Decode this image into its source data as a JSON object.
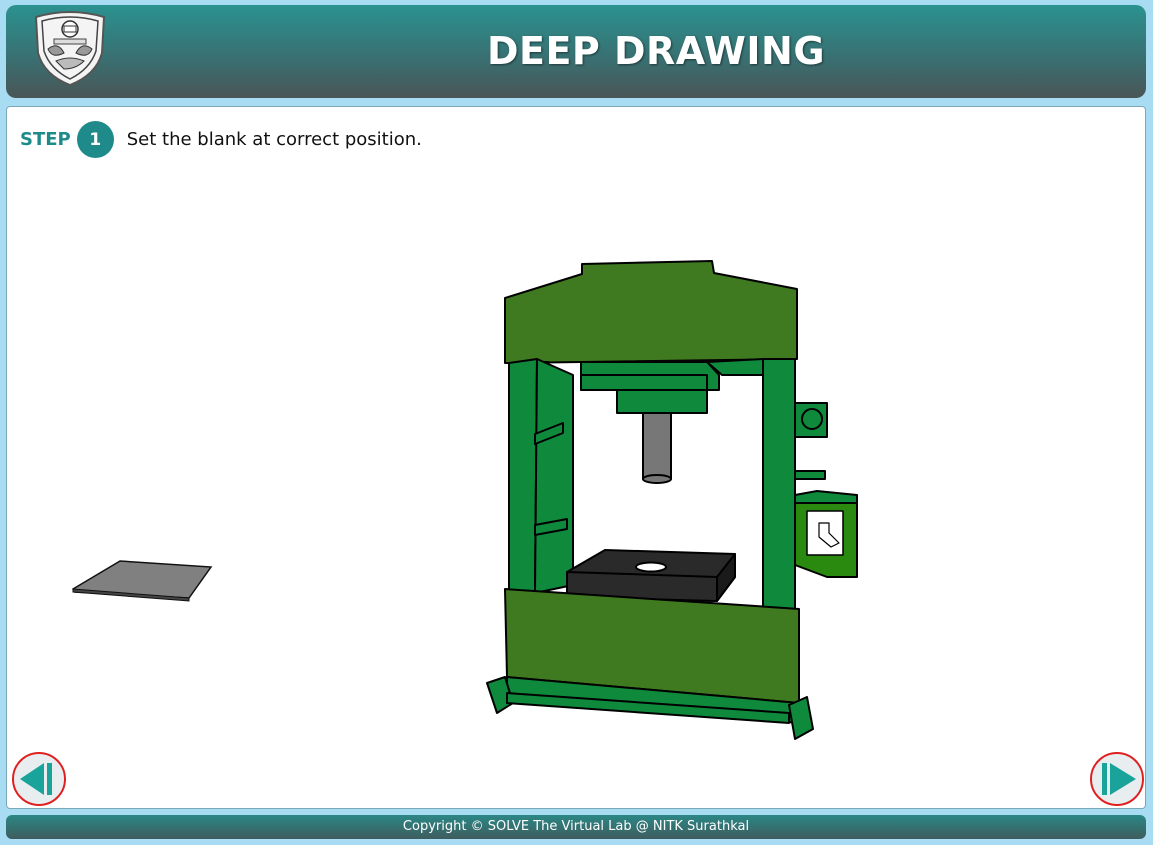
{
  "header": {
    "title": "DEEP DRAWING",
    "logo_icon": "nitk-crest-logo"
  },
  "step": {
    "label": "STEP",
    "number": "1",
    "instruction": "Set the blank at correct position."
  },
  "scene": {
    "blank_sheet_icon": "metal-blank-sheet",
    "machine_icon": "hydraulic-press-machine",
    "colors": {
      "frame_dark": "#3f7a20",
      "column_green": "#0f8a3c",
      "die_black": "#2a2a2a",
      "ram_grey": "#777777",
      "blank_grey": "#808080"
    }
  },
  "navigation": {
    "prev_icon": "previous-step-icon",
    "next_icon": "next-step-icon",
    "accent": "#1aa39a",
    "ring": "#e02020"
  },
  "footer": {
    "text": "Copyright © SOLVE The Virtual Lab @ NITK Surathkal"
  }
}
